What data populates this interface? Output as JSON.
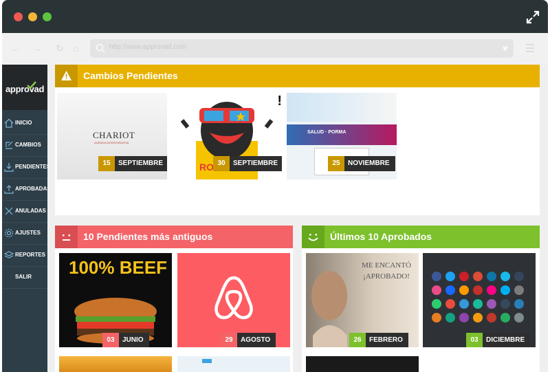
{
  "browser": {
    "url": "http://www.approvad.com"
  },
  "app": {
    "logo_text": "approvad"
  },
  "sidebar": {
    "items": [
      {
        "label": "INICIO",
        "icon": "home-icon"
      },
      {
        "label": "CAMBIOS",
        "icon": "edit-icon"
      },
      {
        "label": "PENDIENTES",
        "icon": "download-icon"
      },
      {
        "label": "APROBADAS",
        "icon": "upload-icon"
      },
      {
        "label": "ANULADAS",
        "icon": "x-icon"
      },
      {
        "label": "AJUSTES",
        "icon": "gear-icon"
      },
      {
        "label": "REPORTES",
        "icon": "layers-icon"
      },
      {
        "label": "SALIR",
        "icon": ""
      }
    ]
  },
  "pending_changes": {
    "title": "Cambios Pendientes",
    "color": "#e8b100",
    "items": [
      {
        "day": "15",
        "month": "SEPTIEMBRE",
        "thumb_text": "CHARIOT",
        "thumb_sub": "AGENCIA INTERCREATIVA"
      },
      {
        "day": "30",
        "month": "SEPTIEMBRE",
        "thumb_text": "ROCK STAR"
      },
      {
        "day": "25",
        "month": "NOVIEMBRE",
        "thumb_text": "SALUD · PORMA"
      }
    ]
  },
  "oldest_pending": {
    "title": "10 Pendientes más antiguos",
    "color": "#f36367",
    "items": [
      {
        "day": "03",
        "month": "JUNIO",
        "thumb_text": "100% BEEF"
      },
      {
        "day": "29",
        "month": "AGOSTO",
        "thumb_text": "airbnb"
      }
    ]
  },
  "last_approved": {
    "title": "Últimos 10 Aprobados",
    "color": "#7dc12c",
    "items": [
      {
        "day": "26",
        "month": "FEBRERO",
        "thumb_text": "ME ENCANTÓ ¡APROBADO!"
      },
      {
        "day": "03",
        "month": "DICIEMBRE",
        "thumb_text": "social icons"
      }
    ]
  }
}
